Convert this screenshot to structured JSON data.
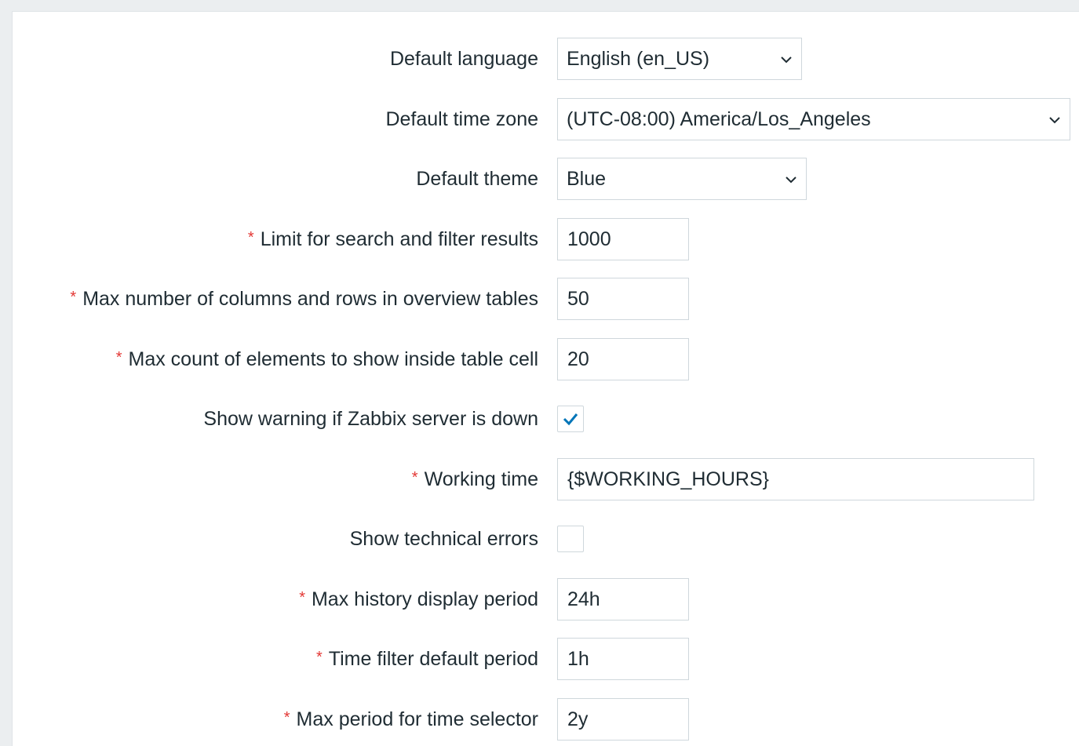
{
  "form": {
    "default_language": {
      "label": "Default language",
      "value": "English (en_US)"
    },
    "default_time_zone": {
      "label": "Default time zone",
      "value": "(UTC-08:00) America/Los_Angeles"
    },
    "default_theme": {
      "label": "Default theme",
      "value": "Blue"
    },
    "search_limit": {
      "label": "Limit for search and filter results",
      "value": "1000",
      "required": true
    },
    "overview_max": {
      "label": "Max number of columns and rows in overview tables",
      "value": "50",
      "required": true
    },
    "cell_max_count": {
      "label": "Max count of elements to show inside table cell",
      "value": "20",
      "required": true
    },
    "server_down_warning": {
      "label": "Show warning if Zabbix server is down",
      "checked": true
    },
    "working_time": {
      "label": "Working time",
      "value": "{$WORKING_HOURS}",
      "required": true
    },
    "technical_errors": {
      "label": "Show technical errors",
      "checked": false
    },
    "history_period": {
      "label": "Max history display period",
      "value": "24h",
      "required": true
    },
    "time_filter_period": {
      "label": "Time filter default period",
      "value": "1h",
      "required": true
    },
    "time_selector_max": {
      "label": "Max period for time selector",
      "value": "2y",
      "required": true
    }
  },
  "colors": {
    "required_marker": "#e33734",
    "checkbox_check": "#0275b8",
    "border": "#cfd7dc",
    "page_background": "#ebeef0",
    "text": "#1f2c33"
  },
  "icons": {
    "select": "chevron-down-icon",
    "checkbox": "checkmark-icon"
  }
}
